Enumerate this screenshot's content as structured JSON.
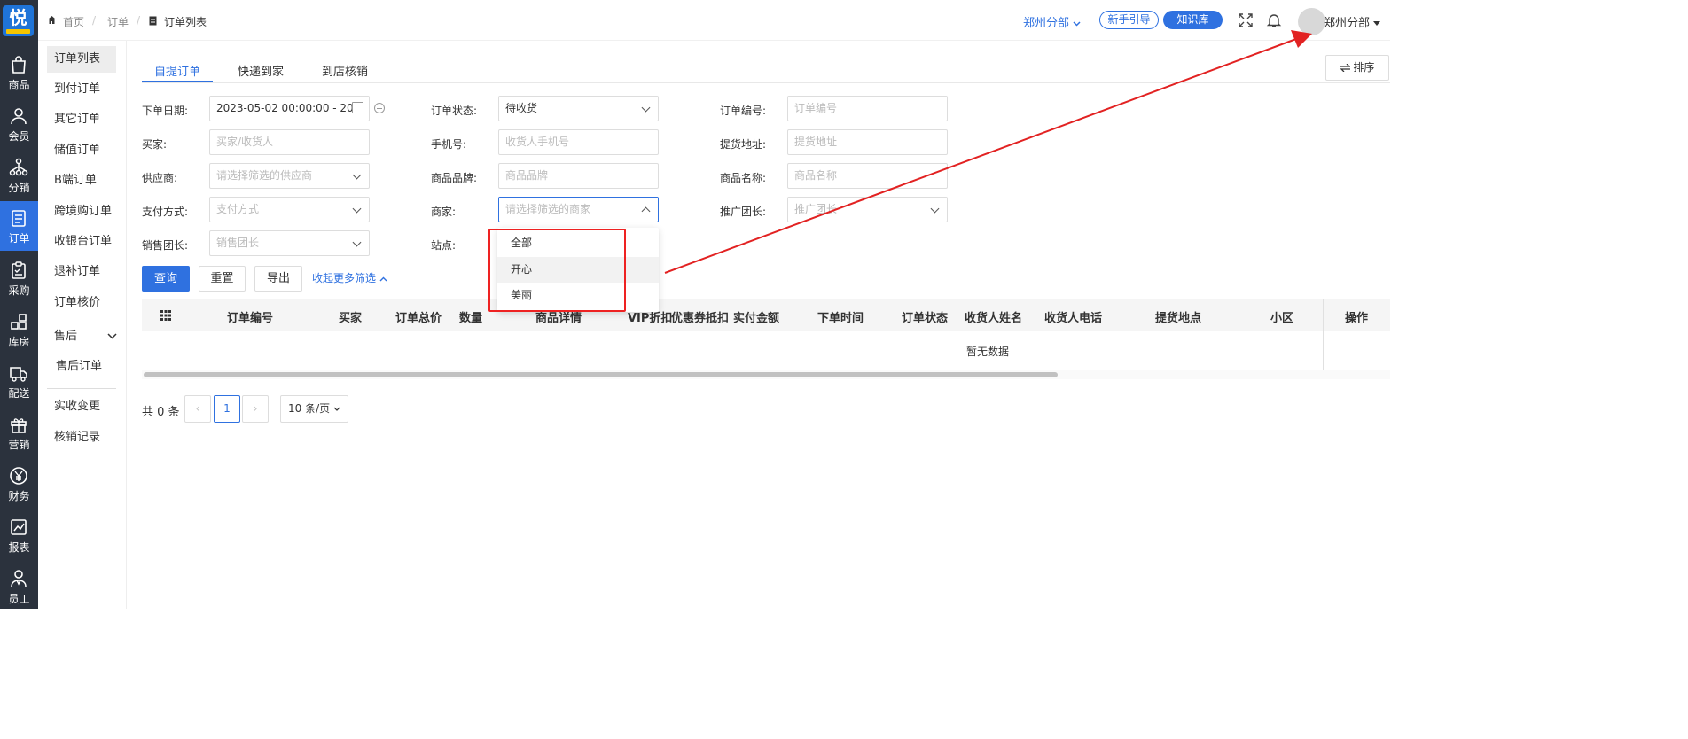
{
  "rail": {
    "logo_glyph": "悦",
    "items": [
      {
        "label": "商品",
        "icon": "bag-icon"
      },
      {
        "label": "会员",
        "icon": "user-icon"
      },
      {
        "label": "分销",
        "icon": "network-icon"
      },
      {
        "label": "订单",
        "icon": "order-icon",
        "active": true
      },
      {
        "label": "采购",
        "icon": "clipboard-icon"
      },
      {
        "label": "库房",
        "icon": "warehouse-icon"
      },
      {
        "label": "配送",
        "icon": "truck-icon"
      },
      {
        "label": "营销",
        "icon": "gift-icon"
      },
      {
        "label": "财务",
        "icon": "yuan-icon"
      },
      {
        "label": "报表",
        "icon": "chart-icon"
      },
      {
        "label": "员工",
        "icon": "staff-icon"
      }
    ]
  },
  "header": {
    "breadcrumb": [
      "首页",
      "订单",
      "订单列表"
    ],
    "branch": "郑州分部",
    "guide_button": "新手引导",
    "knowledge_button": "知识库",
    "user_name": "郑州分部"
  },
  "submenu": {
    "items": [
      "订单列表",
      "到付订单",
      "其它订单",
      "储值订单",
      "B端订单",
      "跨境购订单",
      "收银台订单",
      "退补订单",
      "订单核价",
      "售后",
      "售后订单",
      "实收变更",
      "核销记录"
    ]
  },
  "tabs": [
    "自提订单",
    "快递到家",
    "到店核销"
  ],
  "sort_button": "排序",
  "filters": {
    "order_date": {
      "label": "下单日期:",
      "value": "2023-05-02 00:00:00 - 20"
    },
    "order_status": {
      "label": "订单状态:",
      "value": "待收货"
    },
    "order_no": {
      "label": "订单编号:",
      "placeholder": "订单编号"
    },
    "buyer": {
      "label": "买家:",
      "placeholder": "买家/收货人"
    },
    "phone": {
      "label": "手机号:",
      "placeholder": "收货人手机号"
    },
    "pickup_address": {
      "label": "提货地址:",
      "placeholder": "提货地址"
    },
    "supplier": {
      "label": "供应商:",
      "placeholder": "请选择筛选的供应商"
    },
    "brand": {
      "label": "商品品牌:",
      "placeholder": "商品品牌"
    },
    "product_name": {
      "label": "商品名称:",
      "placeholder": "商品名称"
    },
    "pay_method": {
      "label": "支付方式:",
      "placeholder": "支付方式"
    },
    "merchant": {
      "label": "商家:",
      "placeholder": "请选择筛选的商家"
    },
    "promoter": {
      "label": "推广团长:",
      "placeholder": "推广团长"
    },
    "sales_leader": {
      "label": "销售团长:",
      "placeholder": "销售团长"
    },
    "site": {
      "label": "站点:"
    }
  },
  "actions": {
    "query": "查询",
    "reset": "重置",
    "export": "导出",
    "collapse": "收起更多筛选"
  },
  "merchant_dropdown": [
    "全部",
    "开心",
    "美丽"
  ],
  "table": {
    "columns": [
      "订单编号",
      "买家",
      "订单总价",
      "数量",
      "商品详情",
      "VIP折扣",
      "优惠券抵扣",
      "实付金额",
      "下单时间",
      "订单状态",
      "收货人姓名",
      "收货人电话",
      "提货地点",
      "小区",
      "操作"
    ],
    "empty_text": "暂无数据"
  },
  "pagination": {
    "total": "共 0 条",
    "current_page": "1",
    "page_size": "10 条/页"
  },
  "annotation": {
    "color": "#e22222"
  }
}
